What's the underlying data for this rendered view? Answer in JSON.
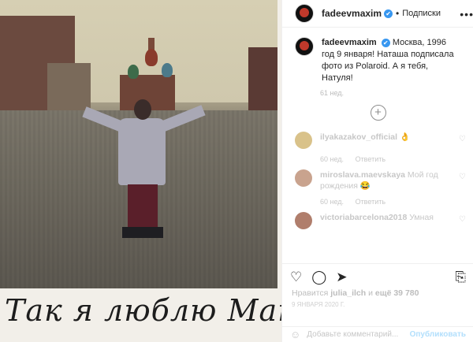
{
  "photo": {
    "caption": "Так я люблю Макса!"
  },
  "header": {
    "username": "fadeevmaxim",
    "verified_mark": "✔",
    "separator": "•",
    "follow_label": "Подписки",
    "more_label": "•••"
  },
  "post": {
    "username": "fadeevmaxim",
    "text": "Москва, 1996 год 9 января! Наташа подписала фото из Polaroid. А я тебя, Натуля!",
    "time": "61 нед."
  },
  "load_more": {
    "icon": "plus-circle-icon",
    "glyph": "+"
  },
  "comments": [
    {
      "username": "ilyakazakov_official",
      "text": "👌",
      "time": "60 нед.",
      "reply": "Ответить",
      "avatar_color": "#d9c28a"
    },
    {
      "username": "miroslava.maevskaya",
      "text": "Мой год рождения 😂",
      "time": "60 нед.",
      "reply": "Ответить",
      "avatar_color": "#c9a38e"
    },
    {
      "username": "victoriabarcelona2018",
      "text": "Умная",
      "time": "",
      "reply": "",
      "avatar_color": "#b07e6c"
    }
  ],
  "actions": {
    "like_icon": "♡",
    "comment_icon": "◯",
    "share_icon": "➤",
    "save_icon": "⎘",
    "likes_prefix": "Нравится ",
    "likes_user": "julia_ilch",
    "likes_mid": " и ",
    "likes_count": "ещё 39 780",
    "date": "9 ЯНВАРЯ 2020 Г."
  },
  "add_comment": {
    "smile_icon": "☺",
    "placeholder": "Добавьте комментарий...",
    "publish_label": "Опубликовать"
  }
}
